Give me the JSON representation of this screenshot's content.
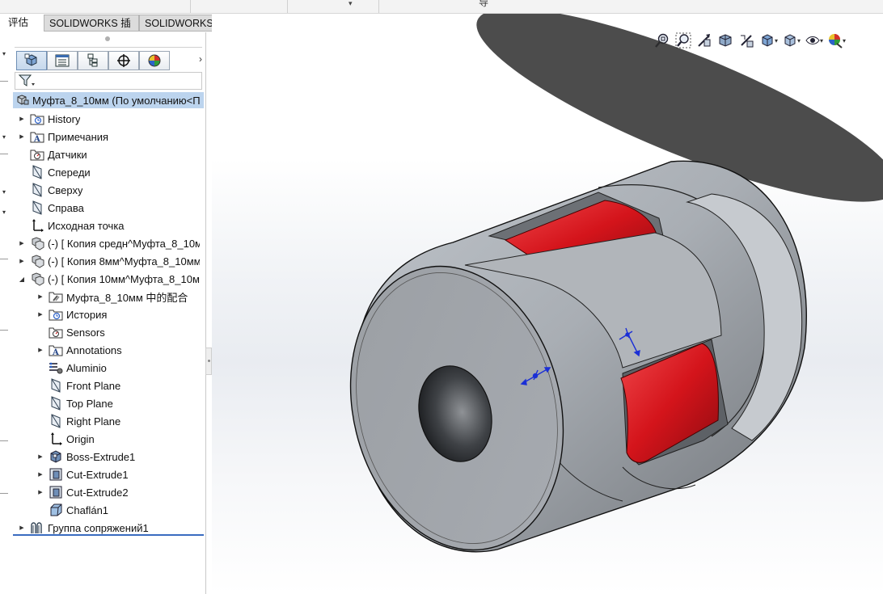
{
  "top_strip": {
    "fragment": "导"
  },
  "command_tabs": [
    "评估",
    "SOLIDWORKS 插件",
    "SOLIDWORKS MBD"
  ],
  "colors": {
    "selection_bg": "#bcd4ee",
    "part_gray": "#a9aeb4",
    "spider_red": "#d4141b",
    "triad_blue": "#1b2fd6"
  },
  "feature_manager": {
    "tab_icons": [
      "feature-manager-icon",
      "property-manager-icon",
      "configuration-manager-icon",
      "dimxpert-icon",
      "display-manager-icon"
    ],
    "filter_icon": "filter-icon",
    "root": {
      "label": "Муфта_8_10мм  (По умолчанию<П",
      "icon": "assembly-icon"
    },
    "items": [
      {
        "label": "History",
        "icon": "history-folder-icon",
        "indent": 0,
        "expander": "collapsed"
      },
      {
        "label": "Примечания",
        "icon": "annotations-icon",
        "indent": 0,
        "expander": "collapsed"
      },
      {
        "label": "Датчики",
        "icon": "sensors-icon",
        "indent": 0,
        "expander": "none"
      },
      {
        "label": "Спереди",
        "icon": "plane-icon",
        "indent": 0,
        "expander": "none"
      },
      {
        "label": "Сверху",
        "icon": "plane-icon",
        "indent": 0,
        "expander": "none"
      },
      {
        "label": "Справа",
        "icon": "plane-icon",
        "indent": 0,
        "expander": "none"
      },
      {
        "label": "Исходная точка",
        "icon": "origin-icon",
        "indent": 0,
        "expander": "none"
      },
      {
        "label": "(-) [ Копия средн^Муфта_8_10м",
        "icon": "part-icon",
        "indent": 0,
        "expander": "collapsed"
      },
      {
        "label": "(-) [ Копия 8мм^Муфта_8_10мм",
        "icon": "part-icon",
        "indent": 0,
        "expander": "collapsed"
      },
      {
        "label": "(-) [ Копия 10мм^Муфта_8_10м",
        "icon": "part-icon",
        "indent": 0,
        "expander": "expanded"
      },
      {
        "label": "Муфта_8_10мм 中的配合",
        "icon": "mates-folder-icon",
        "indent": 1,
        "expander": "collapsed"
      },
      {
        "label": "История",
        "icon": "history-folder-icon",
        "indent": 1,
        "expander": "collapsed"
      },
      {
        "label": "Sensors",
        "icon": "sensors-icon",
        "indent": 1,
        "expander": "none"
      },
      {
        "label": "Annotations",
        "icon": "annotations-icon",
        "indent": 1,
        "expander": "collapsed"
      },
      {
        "label": "Aluminio",
        "icon": "material-icon",
        "indent": 1,
        "expander": "none"
      },
      {
        "label": "Front Plane",
        "icon": "plane-icon",
        "indent": 1,
        "expander": "none"
      },
      {
        "label": "Top Plane",
        "icon": "plane-icon",
        "indent": 1,
        "expander": "none"
      },
      {
        "label": "Right Plane",
        "icon": "plane-icon",
        "indent": 1,
        "expander": "none"
      },
      {
        "label": "Origin",
        "icon": "origin-icon",
        "indent": 1,
        "expander": "none"
      },
      {
        "label": "Boss-Extrude1",
        "icon": "boss-extrude-icon",
        "indent": 1,
        "expander": "collapsed"
      },
      {
        "label": "Cut-Extrude1",
        "icon": "cut-extrude-icon",
        "indent": 1,
        "expander": "collapsed"
      },
      {
        "label": "Cut-Extrude2",
        "icon": "cut-extrude-icon",
        "indent": 1,
        "expander": "collapsed"
      },
      {
        "label": "Chaflán1",
        "icon": "chamfer-icon",
        "indent": 1,
        "expander": "none"
      },
      {
        "label": "Группа сопряжений1",
        "icon": "mates-icon",
        "indent": 0,
        "expander": "collapsed"
      }
    ]
  },
  "heads_up_toolbar": [
    {
      "name": "zoom-to-fit-icon",
      "dropdown": false
    },
    {
      "name": "zoom-to-area-icon",
      "dropdown": false
    },
    {
      "name": "previous-view-icon",
      "dropdown": false
    },
    {
      "name": "section-view-icon",
      "dropdown": false
    },
    {
      "name": "dynamic-annotation-icon",
      "dropdown": false
    },
    {
      "name": "view-orientation-icon",
      "dropdown": true
    },
    {
      "name": "display-style-icon",
      "dropdown": true
    },
    {
      "name": "hide-show-items-icon",
      "dropdown": true
    },
    {
      "name": "edit-appearance-icon",
      "dropdown": true
    }
  ]
}
